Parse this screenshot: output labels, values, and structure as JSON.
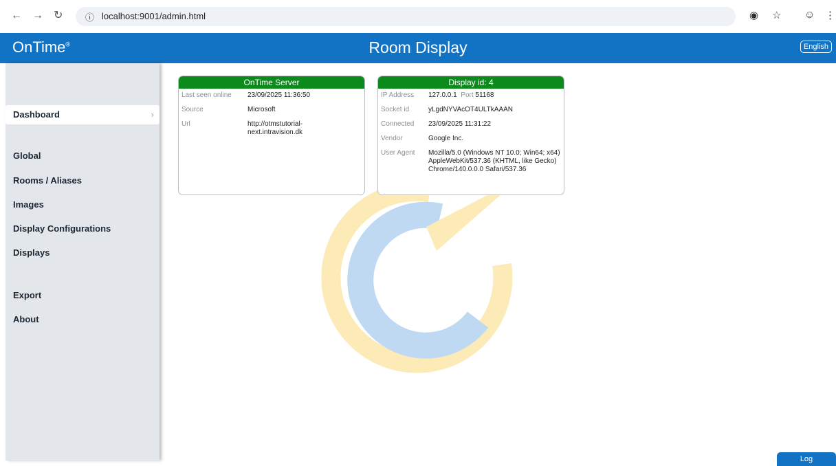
{
  "browser": {
    "url": "localhost:9001/admin.html",
    "icons": [
      "back-icon",
      "forward-icon",
      "reload-icon",
      "info-icon",
      "key-icon",
      "star-icon",
      "profile-icon",
      "menu-icon"
    ]
  },
  "header": {
    "logo": "OnTime",
    "logo_mark": "®",
    "title": "Room Display",
    "language": "English",
    "color": "#1273c4"
  },
  "sidebar": {
    "items": [
      {
        "label": "Dashboard",
        "active": true
      },
      {
        "label": "Global"
      },
      {
        "label": "Rooms / Aliases"
      },
      {
        "label": "Images"
      },
      {
        "label": "Display Configurations"
      },
      {
        "label": "Displays"
      },
      {
        "label": "Export"
      },
      {
        "label": "About"
      }
    ]
  },
  "server_card": {
    "title": "OnTime Server",
    "rows": [
      {
        "label": "Last seen online",
        "value": "23/09/2025 11:36:50"
      },
      {
        "label": "Source",
        "value": "Microsoft"
      },
      {
        "label": "Url",
        "value": "http://otmstutorial-\nnext.intravision.dk"
      }
    ]
  },
  "display_card": {
    "title": "Display id: 4",
    "rows": [
      {
        "label": "IP Address",
        "value": "127.0.0.1",
        "extra_label": "Port",
        "extra_value": "51168"
      },
      {
        "label": "Socket id",
        "value": "yLgdNYVAcOT4ULTkAAAN"
      },
      {
        "label": "Connected",
        "value": "23/09/2025 11:31:22"
      },
      {
        "label": "Vendor",
        "value": "Google Inc."
      },
      {
        "label": "User Agent",
        "value": "Mozilla/5.0 (Windows NT 10.0; Win64; x64) AppleWebKit/537.36 (KHTML, like Gecko) Chrome/140.0.0.0 Safari/537.36"
      }
    ]
  },
  "log_button": "Log",
  "colors": {
    "card_header": "#0d8a1c",
    "sidebar": "#e3e6ea"
  }
}
